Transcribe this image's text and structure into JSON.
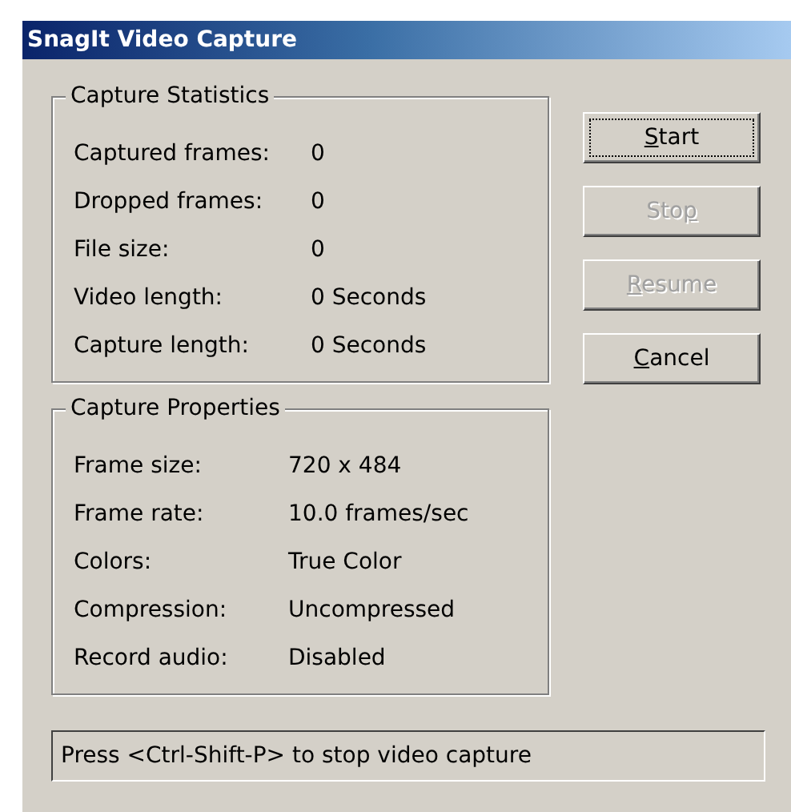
{
  "window": {
    "title": "SnagIt Video Capture"
  },
  "groups": [
    {
      "title": "Capture Statistics",
      "rows": [
        {
          "label": "Captured frames:",
          "value": "0"
        },
        {
          "label": "Dropped frames:",
          "value": "0"
        },
        {
          "label": "File size:",
          "value": "0"
        },
        {
          "label": "Video length:",
          "value": "0 Seconds"
        },
        {
          "label": "Capture length:",
          "value": "0 Seconds"
        }
      ]
    },
    {
      "title": "Capture Properties",
      "rows": [
        {
          "label": "Frame size:",
          "value": "720 x 484"
        },
        {
          "label": "Frame rate:",
          "value": "10.0 frames/sec"
        },
        {
          "label": "Colors:",
          "value": "True Color"
        },
        {
          "label": "Compression:",
          "value": "Uncompressed"
        },
        {
          "label": "Record audio:",
          "value": "Disabled"
        }
      ]
    }
  ],
  "buttons": [
    {
      "key": "S",
      "post": "tart",
      "disabled": false,
      "focused": true
    },
    {
      "pre": "Sto",
      "key": "p",
      "disabled": true,
      "focused": false
    },
    {
      "key": "R",
      "post": "esume",
      "disabled": true,
      "focused": false
    },
    {
      "key": "C",
      "post": "ancel",
      "disabled": false,
      "focused": false
    }
  ],
  "status_bar": {
    "text": "Press <Ctrl-Shift-P> to stop video capture"
  }
}
